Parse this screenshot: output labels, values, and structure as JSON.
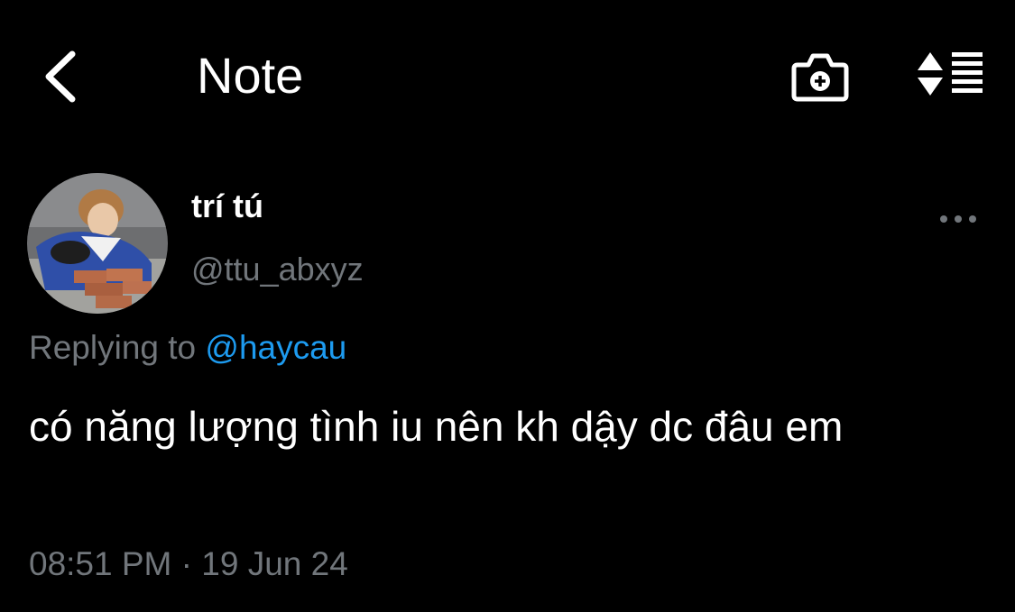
{
  "header": {
    "title": "Note",
    "back_icon": "chevron-left-icon",
    "camera_icon": "camera-plus-icon",
    "sort_icon": "sort-list-icon"
  },
  "author": {
    "display_name": "trí tú",
    "handle": "@ttu_abxyz",
    "avatar_icon": "avatar-photo"
  },
  "tweet": {
    "reply_prefix": "Replying to ",
    "reply_mention": "@haycau",
    "text": "có năng lượng tình iu nên kh dậy dc đâu em",
    "time": "08:51 PM",
    "separator": " · ",
    "date": "19 Jun 24"
  },
  "colors": {
    "background": "#000000",
    "text_primary": "#ffffff",
    "text_secondary": "#71767b",
    "accent": "#1d9bf0"
  }
}
